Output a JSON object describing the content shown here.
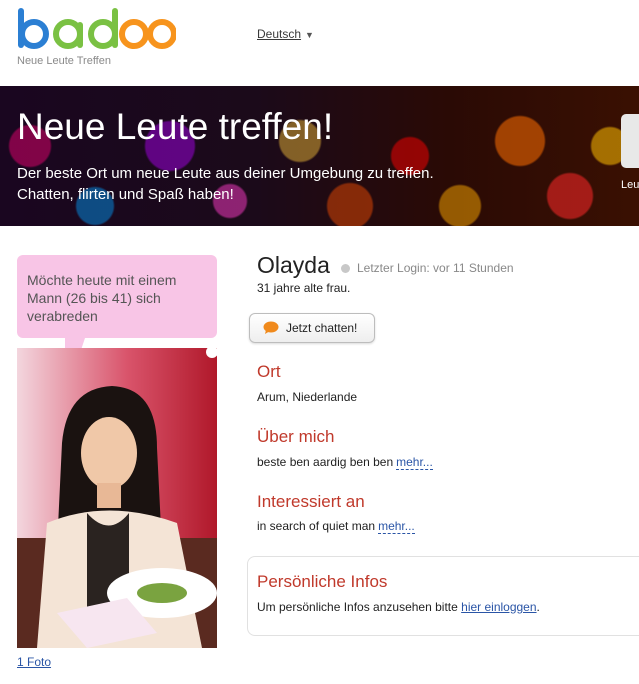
{
  "header": {
    "logo_text": "badoo",
    "tagline": "Neue Leute Treffen",
    "language": "Deutsch",
    "colors": {
      "blue": "#2b7fd3",
      "green": "#7ac143",
      "orange": "#f7941d",
      "red": "#e84c3d",
      "purple": "#8e44ad"
    }
  },
  "banner": {
    "title": "Neue Leute treffen!",
    "subtitle": "Der beste Ort um neue Leute aus deiner Umgebung zu treffen. Chatten, flirten und Spaß haben!",
    "widget_label": "Leu"
  },
  "profile": {
    "status_bubble": "Möchte heute mit einem Mann (26 bis 41) sich verabreden",
    "photo_count": "1 Foto",
    "name": "Olayda",
    "last_login": "Letzter Login: vor 11 Stunden",
    "age_text": "31 jahre alte frau.",
    "chat_button": "Jetzt chatten!"
  },
  "sections": {
    "location": {
      "heading": "Ort",
      "text": "Arum, Niederlande"
    },
    "about": {
      "heading": "Über mich",
      "text": "beste ben aardig ben ben",
      "more": "mehr..."
    },
    "interests": {
      "heading": "Interessiert an",
      "text": "in search of quiet man",
      "more": "mehr..."
    },
    "personal": {
      "heading": "Persönliche Infos",
      "text": "Um persönliche Infos anzusehen bitte",
      "link": "hier einloggen",
      "suffix": "."
    }
  },
  "colors": {
    "accent_red": "#c0392b",
    "link_blue": "#2a55a6",
    "bubble_pink": "#f8c5e6"
  }
}
